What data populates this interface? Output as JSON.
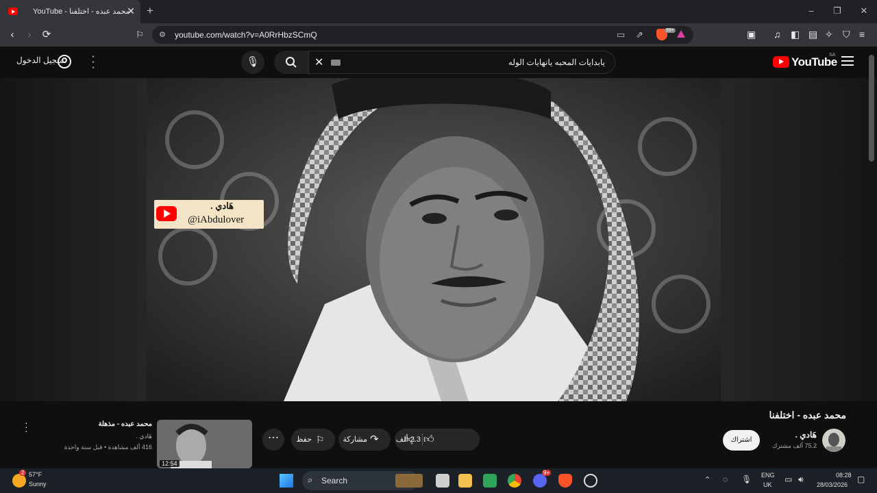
{
  "browser": {
    "tab_title": "YouTube - محمد عبده - اختلفنا",
    "new_tab": "+",
    "url": "youtube.com/watch?v=A0RrHbzSCmQ",
    "brave_badge": "99+"
  },
  "header": {
    "logo_text": "YouTube",
    "country_code": "SA",
    "search_query": "يابدايات المحبه يانهايات الوله",
    "sign_in": "تسجيل الدخول"
  },
  "watermark": {
    "channel": "هَادي .",
    "handle": "@iAbdulover"
  },
  "video": {
    "title": "محمد عبده - اختلفنا",
    "channel_name": "هَادي .",
    "subscribers": "75.2 ألف مشترك",
    "subscribe_label": "اشتراك",
    "likes": "2.3 ألف",
    "share_label": "مشاركة",
    "save_label": "حفظ"
  },
  "up_next": {
    "title": "محمد عبده - مذهلة",
    "channel": "هَادي .",
    "meta": "416 ألف مشاهدة • قبل سنة واحدة",
    "duration": "12:54"
  },
  "taskbar": {
    "weather_badge": "2",
    "temperature": "57°F",
    "condition": "Sunny",
    "search_label": "Search",
    "discord_badge": "9+",
    "lang": "ENG",
    "region": "UK",
    "time": "08:28",
    "date": "28/03/2026"
  }
}
